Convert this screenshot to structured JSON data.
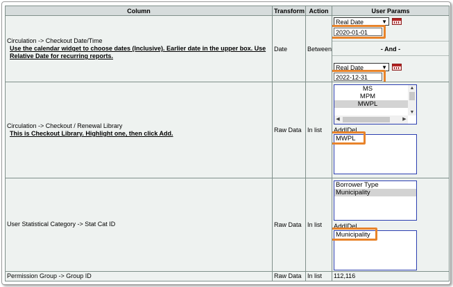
{
  "headers": {
    "column": "Column",
    "transform": "Transform",
    "action": "Action",
    "user_params": "User Params"
  },
  "rows": [
    {
      "column": "Circulation -> Checkout Date/Time",
      "hint": "Use the calendar widget to choose dates (Inclusive). Earlier date in the upper box. Use Relative Date for recurring reports.",
      "transform": "Date",
      "action": "Between",
      "date_type_1": "Real Date",
      "date_1": "2020-01-01",
      "and_label": "- And -",
      "date_type_2": "Real Date",
      "date_2": "2022-12-31"
    },
    {
      "column": "Circulation -> Checkout / Renewal Library",
      "hint": "This is Checkout Library. Highlight one, then click Add.",
      "transform": "Raw Data",
      "action": "In list",
      "options": [
        "MS",
        "MPM",
        "MWPL"
      ],
      "add_label": "Add",
      "sep": "|",
      "del_label": "Del",
      "selected": [
        "MWPL"
      ]
    },
    {
      "column": "User Statistical Category -> Stat Cat ID",
      "transform": "Raw Data",
      "action": "In list",
      "options": [
        "Borrower Type",
        "Municipality"
      ],
      "add_label": "Add",
      "sep": "|",
      "del_label": "Del",
      "selected": [
        "Municipality"
      ]
    },
    {
      "column": "Permission Group -> Group ID",
      "transform": "Raw Data",
      "action": "In list",
      "value": "112,116"
    }
  ],
  "icons": {
    "calendar": "calendar-icon"
  },
  "colors": {
    "highlight": "#e8832a",
    "listbox_border": "#2a3db0",
    "header_bg": "#d6dcdc",
    "row_bg": "#eef2f0"
  }
}
